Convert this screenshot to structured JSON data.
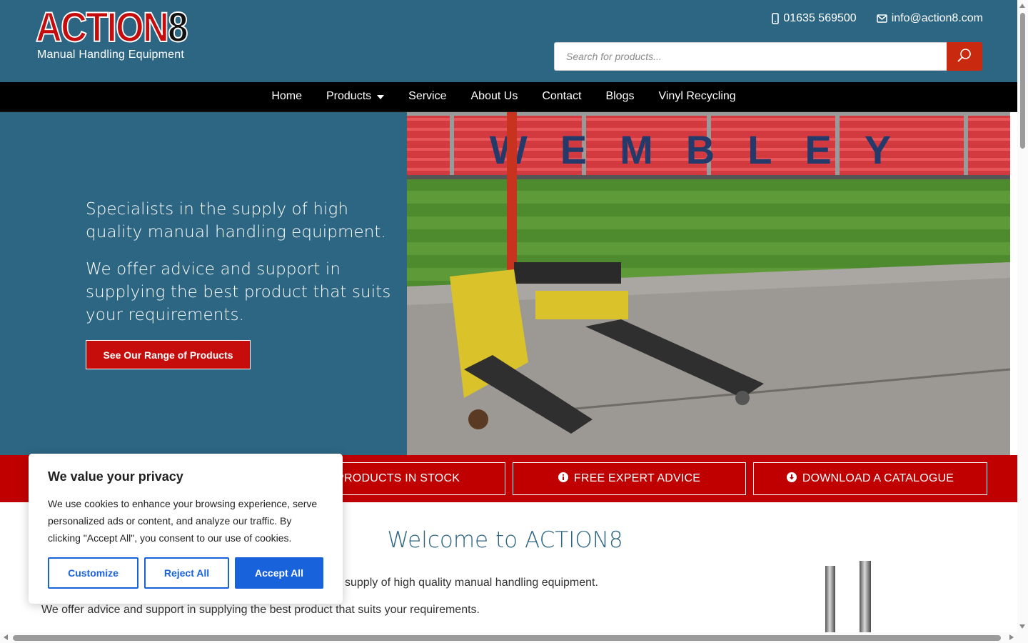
{
  "header": {
    "logo": "ACTION8",
    "tagline": "Manual Handling Equipment",
    "phone": "01635 569500",
    "email": "info@action8.com",
    "search_placeholder": "Search for products..."
  },
  "nav": {
    "items": [
      {
        "label": "Home"
      },
      {
        "label": "Products"
      },
      {
        "label": "Service"
      },
      {
        "label": "About Us"
      },
      {
        "label": "Contact"
      },
      {
        "label": "Blogs"
      },
      {
        "label": "Vinyl Recycling"
      }
    ]
  },
  "hero": {
    "line1": "Specialists in the supply of high quality manual handling equipment.",
    "line2": "We offer advice and support in supplying the best product that suits your requirements.",
    "button": "See Our Range of Products",
    "stadium_text": "WEMBLEY"
  },
  "strip": {
    "stock": "OF PRODUCTS IN STOCK",
    "advice": "FREE EXPERT ADVICE",
    "catalogue": "DOWNLOAD A CATALOGUE"
  },
  "content": {
    "welcome": "Welcome to ACTION8",
    "para1_visible": "supply of high quality manual handling equipment.",
    "para2": "We offer advice and support in supplying the best product that suits your requirements."
  },
  "cookie": {
    "title": "We value your privacy",
    "body": "We use cookies to enhance your browsing experience, serve personalized ads or content, and analyze our traffic. By clicking \"Accept All\", you consent to our use of cookies.",
    "customize": "Customize",
    "reject": "Reject All",
    "accept": "Accept All"
  },
  "colors": {
    "header_blue": "#2d6683",
    "brand_red": "#c00000",
    "cookie_blue": "#1863dc"
  }
}
